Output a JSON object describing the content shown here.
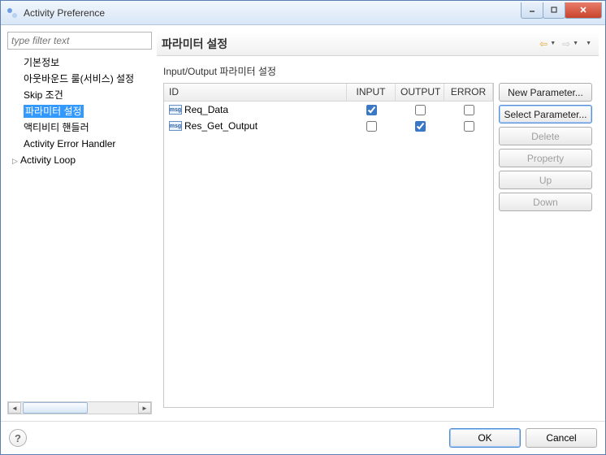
{
  "window": {
    "title": "Activity Preference"
  },
  "sidebar": {
    "filter_placeholder": "type filter text",
    "items": [
      {
        "label": "기본정보",
        "selected": false,
        "children": false
      },
      {
        "label": "아웃바운드 룰(서비스) 설정",
        "selected": false,
        "children": false
      },
      {
        "label": "Skip 조건",
        "selected": false,
        "children": false
      },
      {
        "label": "파라미터 설정",
        "selected": true,
        "children": false
      },
      {
        "label": "액티비티 핸들러",
        "selected": false,
        "children": false
      },
      {
        "label": "Activity Error Handler",
        "selected": false,
        "children": false
      },
      {
        "label": "Activity Loop",
        "selected": false,
        "children": true
      }
    ]
  },
  "main": {
    "title": "파라미터 설정",
    "section_label": "Input/Output 파라미터 설정",
    "columns": {
      "id": "ID",
      "input": "INPUT",
      "output": "OUTPUT",
      "error": "ERROR"
    },
    "rows": [
      {
        "id": "Req_Data",
        "input": true,
        "output": false,
        "error": false
      },
      {
        "id": "Res_Get_Output",
        "input": false,
        "output": true,
        "error": false
      }
    ],
    "buttons": {
      "new": "New Parameter...",
      "select": "Select Parameter...",
      "delete": "Delete",
      "property": "Property",
      "up": "Up",
      "down": "Down"
    }
  },
  "footer": {
    "ok": "OK",
    "cancel": "Cancel"
  }
}
